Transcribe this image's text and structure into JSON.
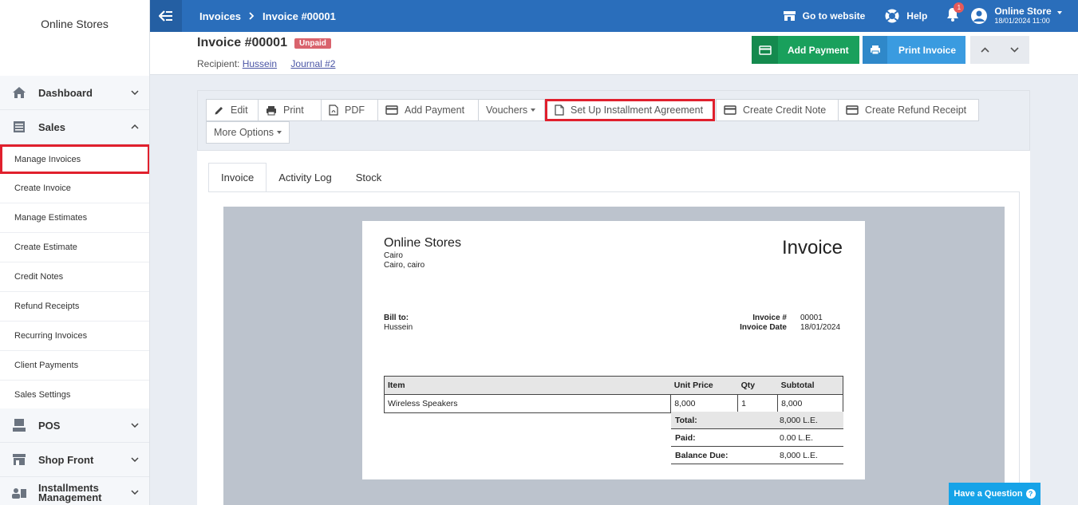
{
  "sidebar": {
    "brand": "Online Stores",
    "groups": [
      {
        "label": "Dashboard"
      },
      {
        "label": "Sales"
      },
      {
        "label": "POS"
      },
      {
        "label": "Shop Front"
      },
      {
        "label": "Installments Management"
      }
    ],
    "sales_items": [
      "Manage Invoices",
      "Create Invoice",
      "Manage Estimates",
      "Create Estimate",
      "Credit Notes",
      "Refund Receipts",
      "Recurring Invoices",
      "Client Payments",
      "Sales Settings"
    ]
  },
  "topbar": {
    "breadcrumb": [
      "Invoices",
      "Invoice #00001"
    ],
    "go_to_website": "Go to website",
    "help": "Help",
    "notification_count": "1",
    "user_name": "Online Store",
    "user_date": "18/01/2024 11:00"
  },
  "header": {
    "title": "Invoice #00001",
    "status": "Unpaid",
    "recipient_label": "Recipient:",
    "recipient_name": "Hussein",
    "journal": "Journal #2",
    "add_payment": "Add Payment",
    "print_invoice": "Print Invoice"
  },
  "toolbar": {
    "edit": "Edit",
    "print": "Print",
    "pdf": "PDF",
    "add_payment": "Add Payment",
    "vouchers": "Vouchers",
    "installment": "Set Up Installment Agreement",
    "credit_note": "Create Credit Note",
    "refund_receipt": "Create Refund Receipt",
    "more_options": "More Options"
  },
  "tabs": [
    "Invoice",
    "Activity Log",
    "Stock"
  ],
  "invoice": {
    "company": "Online Stores",
    "address1": "Cairo",
    "address2": "Cairo, cairo",
    "doc_title": "Invoice",
    "bill_to_label": "Bill to:",
    "bill_to_name": "Hussein",
    "invoice_no_label": "Invoice #",
    "invoice_no": "00001",
    "invoice_date_label": "Invoice Date",
    "invoice_date": "18/01/2024",
    "columns": [
      "Item",
      "Unit Price",
      "Qty",
      "Subtotal"
    ],
    "rows": [
      {
        "item": "Wireless Speakers",
        "unit_price": "8,000",
        "qty": "1",
        "subtotal": "8,000"
      }
    ],
    "total_label": "Total:",
    "total": "8,000 L.E.",
    "paid_label": "Paid:",
    "paid": "0.00 L.E.",
    "balance_label": "Balance Due:",
    "balance": "8,000 L.E."
  },
  "help_button": "Have a Question",
  "colors": {
    "topbar": "#2a6ebb",
    "add_payment": "#19a05c",
    "print_invoice": "#3a9be0",
    "unpaid_badge": "#d9636d",
    "highlight": "#e0202d",
    "help": "#16a3e8"
  }
}
